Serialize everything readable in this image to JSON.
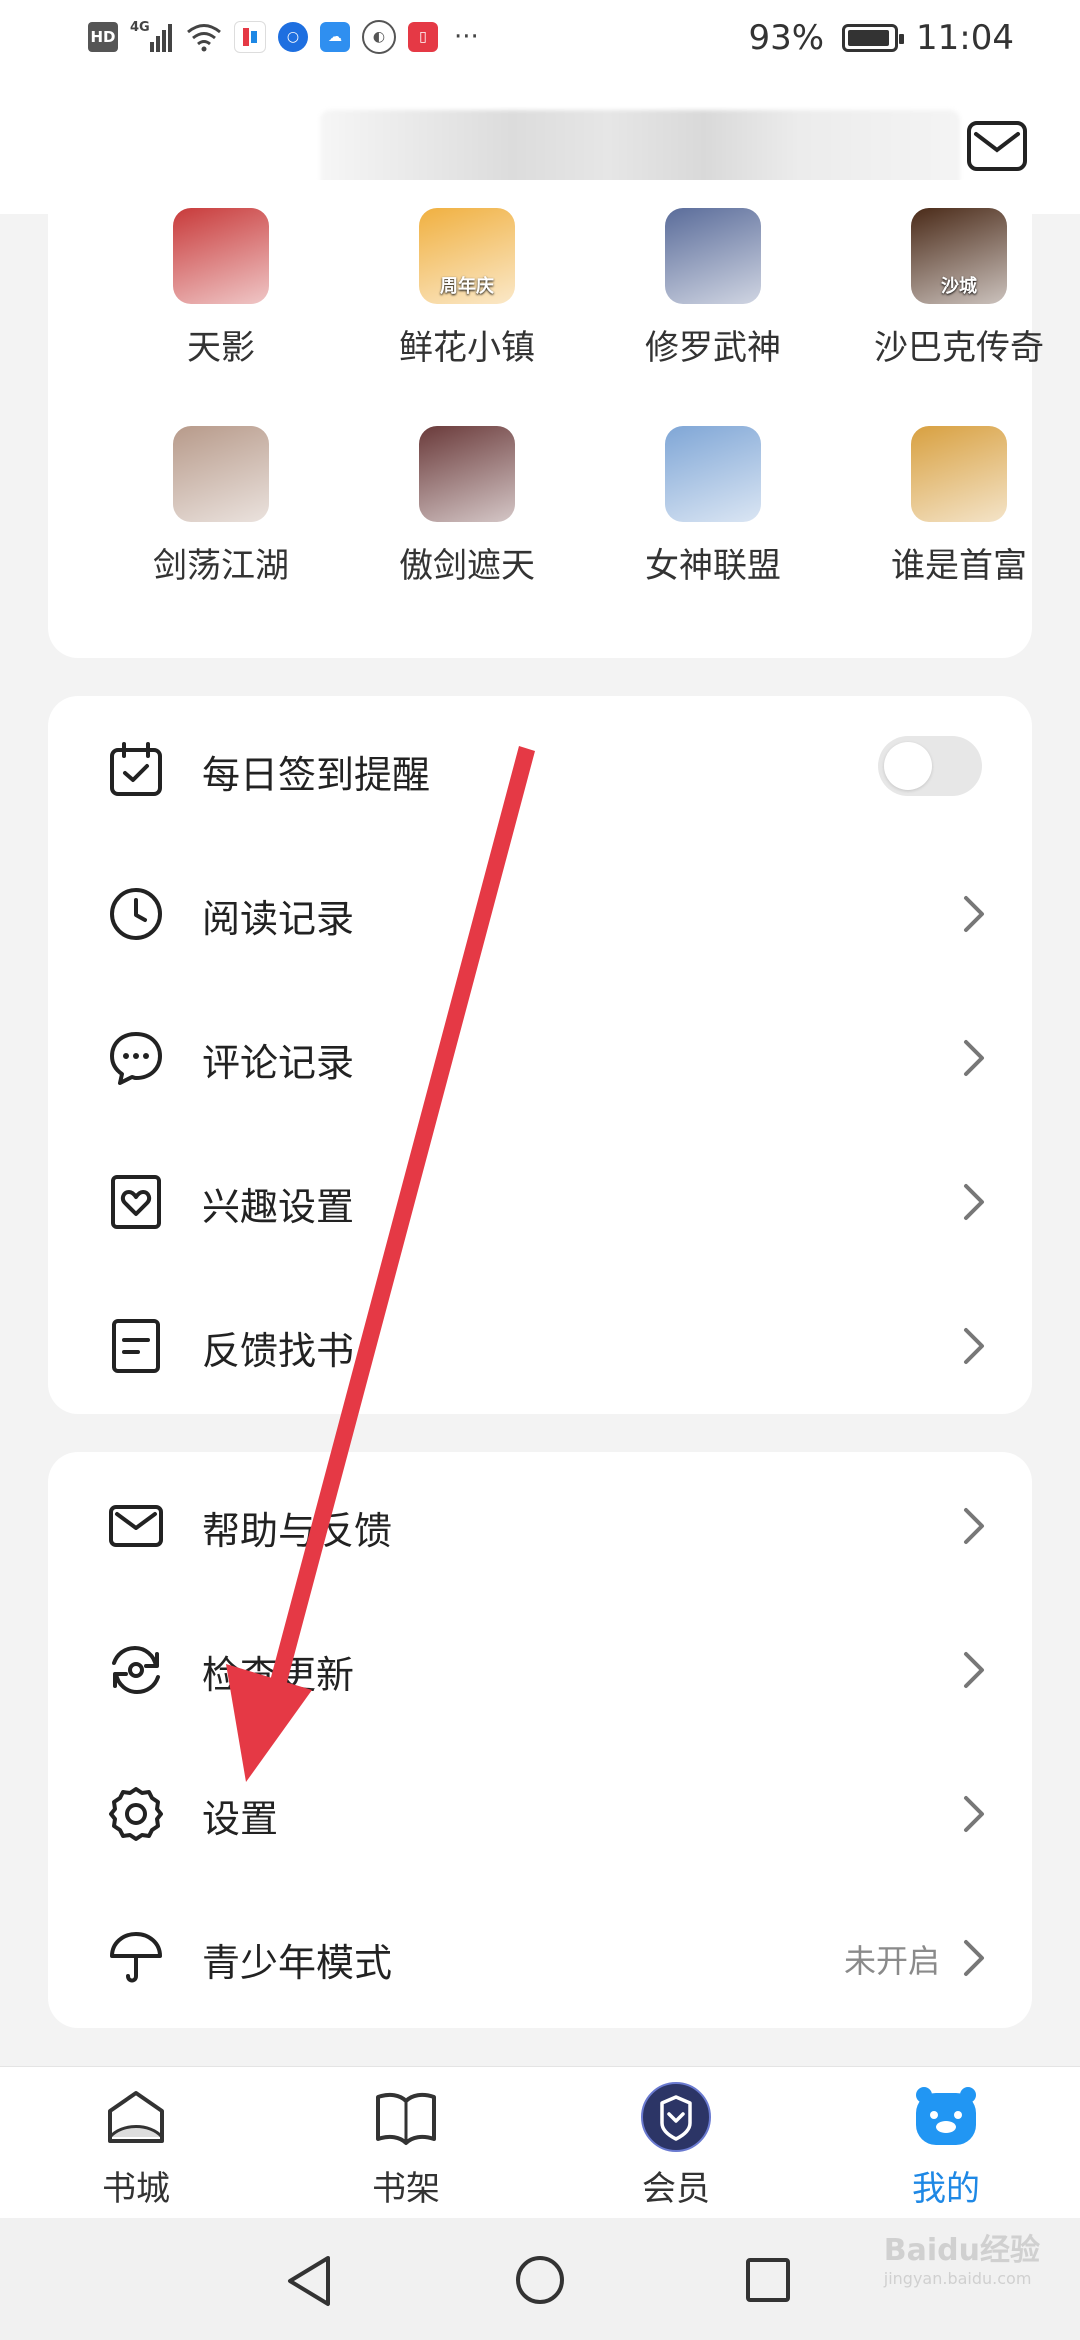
{
  "status_bar": {
    "left_icons": [
      "hd-icon",
      "signal-4g-icon",
      "wifi-icon",
      "app-notification-icon",
      "bulb-icon",
      "cloud-icon",
      "globe-icon",
      "book-app-icon"
    ],
    "more": "···",
    "battery_percent": "93%",
    "battery_level": 0.93,
    "time": "11:04"
  },
  "header": {
    "mail_icon": "mail-icon"
  },
  "games": [
    {
      "name": "天影",
      "color": "#c83a3a"
    },
    {
      "name": "鲜花小镇",
      "color": "#f0b040",
      "badge": "周年庆"
    },
    {
      "name": "修罗武神",
      "color": "#5a6c9a"
    },
    {
      "name": "沙巴克传奇",
      "color": "#4a2a18",
      "badge": "沙城"
    },
    {
      "name": "剑荡江湖",
      "color": "#b79a8a"
    },
    {
      "name": "傲剑遮天",
      "color": "#6a3a3a"
    },
    {
      "name": "女神联盟",
      "color": "#7fa6d6"
    },
    {
      "name": "谁是首富",
      "color": "#d8a040"
    }
  ],
  "menu1": {
    "items": [
      {
        "label": "每日签到提醒",
        "icon": "calendar-check-icon",
        "toggle": false
      },
      {
        "label": "阅读记录",
        "icon": "clock-icon"
      },
      {
        "label": "评论记录",
        "icon": "comment-icon"
      },
      {
        "label": "兴趣设置",
        "icon": "heart-frame-icon"
      },
      {
        "label": "反馈找书",
        "icon": "document-icon"
      }
    ]
  },
  "menu2": {
    "items": [
      {
        "label": "帮助与反馈",
        "icon": "mail-icon"
      },
      {
        "label": "检查更新",
        "icon": "refresh-icon"
      },
      {
        "label": "设置",
        "icon": "gear-icon"
      },
      {
        "label": "青少年模式",
        "icon": "umbrella-icon",
        "value": "未开启"
      }
    ]
  },
  "bottom_nav": [
    {
      "label": "书城",
      "icon": "home-book-icon"
    },
    {
      "label": "书架",
      "icon": "open-book-icon"
    },
    {
      "label": "会员",
      "icon": "vip-badge-icon"
    },
    {
      "label": "我的",
      "icon": "mascot-icon",
      "active": true
    }
  ],
  "colors": {
    "accent": "#1e88e5",
    "arrow": "#e53945",
    "vip": "#2c3566"
  },
  "watermark": {
    "brand": "Baidu经验",
    "url": "jingyan.baidu.com"
  }
}
